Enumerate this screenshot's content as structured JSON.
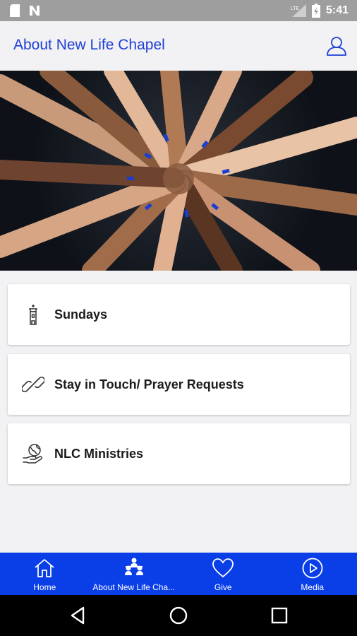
{
  "status_bar": {
    "time": "5:41",
    "icons": [
      "sd-card-icon",
      "n-notification-icon",
      "lte-signal-icon",
      "battery-icon"
    ]
  },
  "app_bar": {
    "title": "About New Life Chapel",
    "profile_icon": "profile-icon"
  },
  "hero": {
    "image_subject": "circle of hands",
    "icon": "hero-image"
  },
  "cards": [
    {
      "label": "Sundays",
      "icon": "church-tower-icon"
    },
    {
      "label": "Stay in Touch/ Prayer Requests",
      "icon": "link-chain-icon"
    },
    {
      "label": "NLC Ministries",
      "icon": "globe-hand-icon"
    }
  ],
  "bottom_nav": {
    "items": [
      {
        "label": "Home",
        "icon": "home-icon"
      },
      {
        "label": "About New Life Cha...",
        "icon": "people-group-icon"
      },
      {
        "label": "Give",
        "icon": "heart-icon"
      },
      {
        "label": "Media",
        "icon": "play-circle-icon"
      }
    ],
    "background": "#0a3fe8"
  },
  "colors": {
    "accent": "#1e3fd6",
    "status_bar": "#9e9e9e",
    "system_nav": "#000000"
  }
}
